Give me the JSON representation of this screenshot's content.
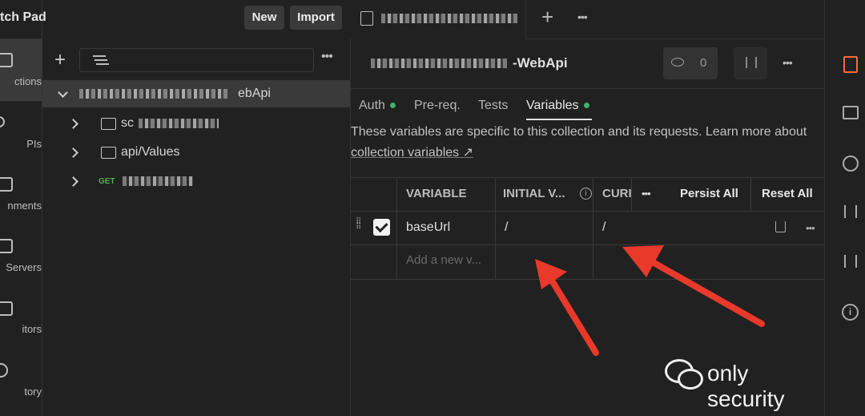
{
  "header": {
    "title": "tch Pad",
    "new_label": "New",
    "import_label": "Import"
  },
  "rail": {
    "items": [
      {
        "label": "ctions"
      },
      {
        "label": "PIs"
      },
      {
        "label": "nments"
      },
      {
        "label": "Servers"
      },
      {
        "label": "itors"
      },
      {
        "label": "tory"
      }
    ]
  },
  "sidebar": {
    "tree": [
      {
        "label_suffix": "ebApi"
      },
      {
        "label": "sc"
      },
      {
        "label": "api/Values"
      },
      {
        "method": "GET"
      }
    ]
  },
  "main": {
    "tab_title_blurred": "",
    "collection_title_suffix": "-WebApi",
    "watch_count": "0",
    "tabs": [
      {
        "label": "Auth",
        "dot": true
      },
      {
        "label": "Pre-req.",
        "dot": false
      },
      {
        "label": "Tests",
        "dot": false
      },
      {
        "label": "Variables",
        "dot": true,
        "active": true
      }
    ],
    "description": "These variables are specific to this collection and its requests. Learn more about",
    "description_link": "collection variables",
    "table": {
      "headers": [
        "VARIABLE",
        "INITIAL V...",
        "CURI"
      ],
      "persist_all": "Persist All",
      "reset_all": "Reset All",
      "rows": [
        {
          "checked": true,
          "variable": "baseUrl",
          "initial": "/",
          "current": "/"
        }
      ],
      "add_placeholder": "Add a new v..."
    }
  },
  "watermark": {
    "text": "only security"
  },
  "colors": {
    "accent": "#f26b3a",
    "active_tab": "#8ec5ff",
    "dot": "#3cb371",
    "arrow": "#e8392b"
  }
}
